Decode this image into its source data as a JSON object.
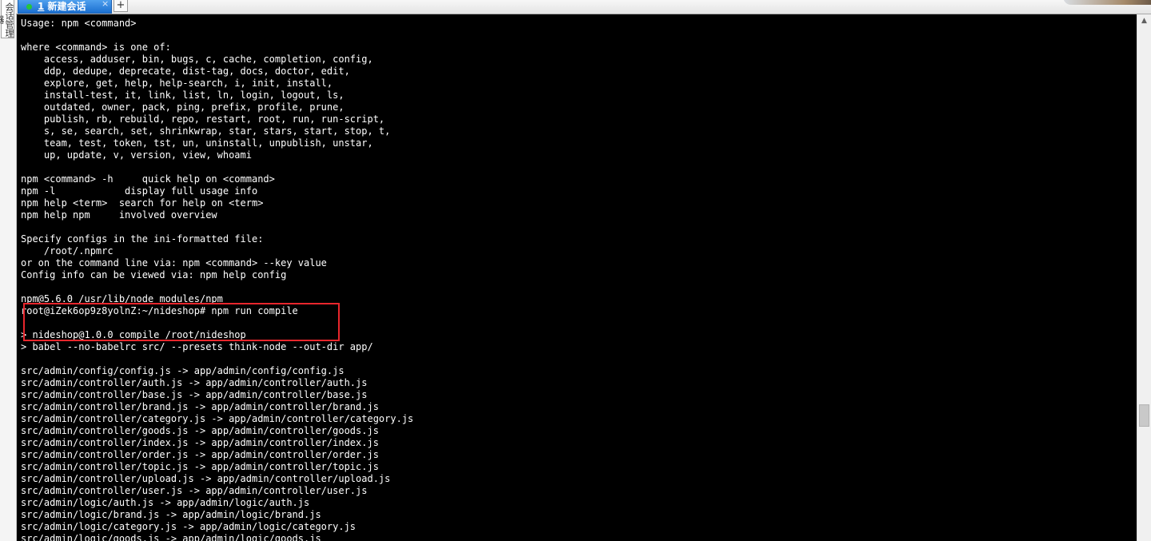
{
  "side_panel": {
    "label": "会话管理器"
  },
  "tab_bar": {
    "session_tab": {
      "number": "1",
      "title": "新建会话",
      "status_color": "#27c63a"
    },
    "close_symbol": "×",
    "new_tab_symbol": "+"
  },
  "terminal": {
    "lines": [
      "Usage: npm <command>",
      "",
      "where <command> is one of:",
      "    access, adduser, bin, bugs, c, cache, completion, config,",
      "    ddp, dedupe, deprecate, dist-tag, docs, doctor, edit,",
      "    explore, get, help, help-search, i, init, install,",
      "    install-test, it, link, list, ln, login, logout, ls,",
      "    outdated, owner, pack, ping, prefix, profile, prune,",
      "    publish, rb, rebuild, repo, restart, root, run, run-script,",
      "    s, se, search, set, shrinkwrap, star, stars, start, stop, t,",
      "    team, test, token, tst, un, uninstall, unpublish, unstar,",
      "    up, update, v, version, view, whoami",
      "",
      "npm <command> -h     quick help on <command>",
      "npm -l            display full usage info",
      "npm help <term>  search for help on <term>",
      "npm help npm     involved overview",
      "",
      "Specify configs in the ini-formatted file:",
      "    /root/.npmrc",
      "or on the command line via: npm <command> --key value",
      "Config info can be viewed via: npm help config",
      "",
      "npm@5.6.0 /usr/lib/node_modules/npm",
      "root@iZek6op9z8yolnZ:~/nideshop# npm run compile",
      "",
      "> nideshop@1.0.0 compile /root/nideshop",
      "> babel --no-babelrc src/ --presets think-node --out-dir app/",
      "",
      "src/admin/config/config.js -> app/admin/config/config.js",
      "src/admin/controller/auth.js -> app/admin/controller/auth.js",
      "src/admin/controller/base.js -> app/admin/controller/base.js",
      "src/admin/controller/brand.js -> app/admin/controller/brand.js",
      "src/admin/controller/category.js -> app/admin/controller/category.js",
      "src/admin/controller/goods.js -> app/admin/controller/goods.js",
      "src/admin/controller/index.js -> app/admin/controller/index.js",
      "src/admin/controller/order.js -> app/admin/controller/order.js",
      "src/admin/controller/topic.js -> app/admin/controller/topic.js",
      "src/admin/controller/upload.js -> app/admin/controller/upload.js",
      "src/admin/controller/user.js -> app/admin/controller/user.js",
      "src/admin/logic/auth.js -> app/admin/logic/auth.js",
      "src/admin/logic/brand.js -> app/admin/logic/brand.js",
      "src/admin/logic/category.js -> app/admin/logic/category.js",
      "src/admin/logic/goods.js -> app/admin/logic/goods.js"
    ],
    "background_color": "#000000",
    "text_color": "#ffffff",
    "highlight_color": "#e8262c"
  }
}
